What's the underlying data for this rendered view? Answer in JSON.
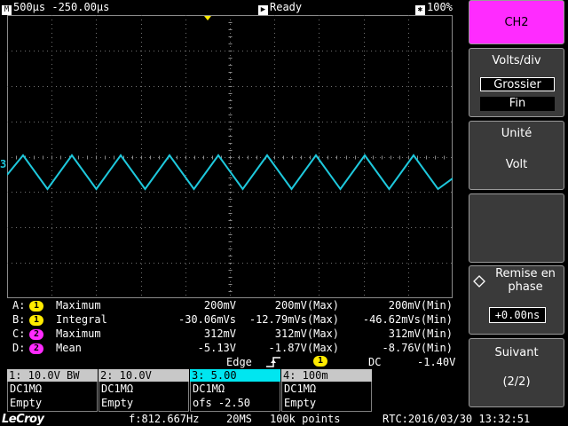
{
  "topbar": {
    "timebase": "500µs",
    "delay": "-250.00µs",
    "status": "Ready",
    "battery": "100%"
  },
  "trace": {
    "channel_marker": "3",
    "color": "#1ec8dc",
    "trigger_pos_color": "#ffeb00",
    "peaks": 19
  },
  "measurements": [
    {
      "slot": "A:",
      "ch": "1",
      "ch_color": "#ffeb00",
      "name": "Maximum",
      "cur": "200mV",
      "max": "200mV(Max)",
      "min": "200mV(Min)"
    },
    {
      "slot": "B:",
      "ch": "1",
      "ch_color": "#ffeb00",
      "name": "Integral",
      "cur": "-30.06mVs",
      "max": "-12.79mVs(Max)",
      "min": "-46.62mVs(Min)"
    },
    {
      "slot": "C:",
      "ch": "2",
      "ch_color": "#ff2bff",
      "name": "Maximum",
      "cur": "312mV",
      "max": "312mV(Max)",
      "min": "312mV(Min)"
    },
    {
      "slot": "D:",
      "ch": "2",
      "ch_color": "#ff2bff",
      "name": "Mean",
      "cur": "-5.13V",
      "max": "-1.87V(Max)",
      "min": "-8.76V(Min)"
    }
  ],
  "trigger": {
    "type": "Edge",
    "source": "1",
    "coupling": "DC",
    "level": "-1.40V"
  },
  "channels": [
    {
      "head": "1: 10.0V  BW",
      "coupling": "DC1MΩ",
      "ofs": "Empty"
    },
    {
      "head": "2: 10.0V",
      "coupling": "DC1MΩ",
      "ofs": "Empty"
    },
    {
      "head": "3:  5.00",
      "coupling": "DC1MΩ",
      "ofs": "ofs     -2.50"
    },
    {
      "head": "4:  100m",
      "coupling": "DC1MΩ",
      "ofs": "Empty"
    }
  ],
  "bottom": {
    "logo": "LeCroy",
    "freq": "f:812.667Hz",
    "rate": "20MS",
    "points": "100k points",
    "rtc": "RTC:2016/03/30 13:32:51"
  },
  "menu": {
    "channel": "CH2",
    "volts_div_title": "Volts/div",
    "coarse": "Grossier",
    "fine": "Fin",
    "unit_title": "Unité",
    "unit_value": "Volt",
    "deskew_title": "Remise en phase",
    "deskew_value": "+0.00ns",
    "next": "Suivant",
    "page": "(2/2)"
  }
}
